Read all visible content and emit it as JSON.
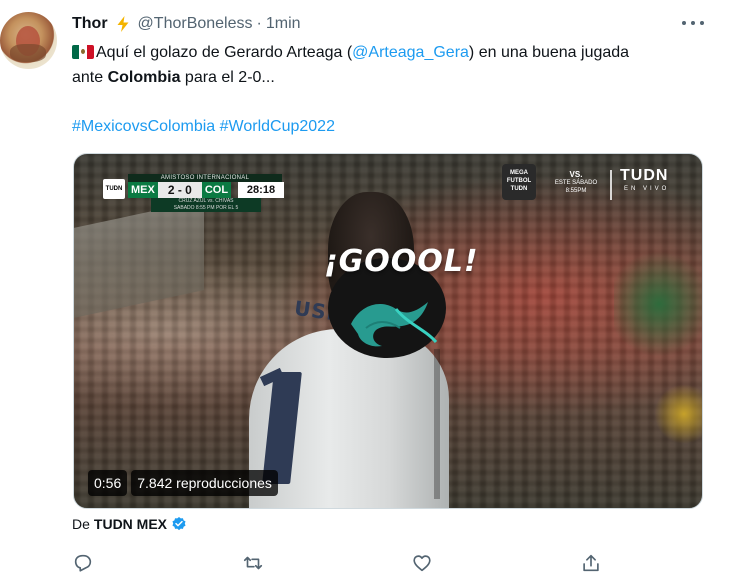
{
  "tweet": {
    "display_name": "Thor",
    "handle": "@ThorBoneless",
    "separator": "·",
    "time": "1min",
    "text": {
      "part1": "Aquí el golazo de Gerardo Arteaga (",
      "mention": "@Arteaga_Gera",
      "part2": ") en una buena jugada",
      "part3": "ante ",
      "bold": "Colombia",
      "part4": " para el 2-0..."
    },
    "hashtags": [
      "#MexicovsColombia",
      "#WorldCup2022"
    ]
  },
  "video": {
    "goal_text": "¡GOOOL!",
    "jersey_name": "USPINA",
    "duration": "0:56",
    "views": "7.842 reproducciones",
    "scorebug": {
      "header": "AMISTOSO INTERNACIONAL",
      "logo": "TUDN",
      "home": "MEX",
      "score": "2 - 0",
      "away": "COL",
      "clock": "28:18",
      "footer_line1": "CRUZ AZUL vs. CHIVAS",
      "footer_line2": "SABADO 8:55 PM POR EL 5"
    },
    "broadcast": {
      "mega": "MEGA FUTBOL TUDN",
      "vs": "VS.",
      "vs_sub1": "ESTE SÁBADO",
      "vs_sub2": "8:55PM",
      "brand": "TUDN",
      "live": "EN VIVO"
    }
  },
  "source": {
    "prefix": "De",
    "name": "TUDN MEX"
  },
  "icons": {
    "bolt": "lightning-icon",
    "verified": "verified-badge-icon",
    "reply": "reply-icon",
    "retweet": "retweet-icon",
    "like": "heart-icon",
    "share": "share-icon",
    "more": "more-icon"
  },
  "colors": {
    "link": "#1d9bf0",
    "text": "#0f1419",
    "muted": "#536471"
  }
}
